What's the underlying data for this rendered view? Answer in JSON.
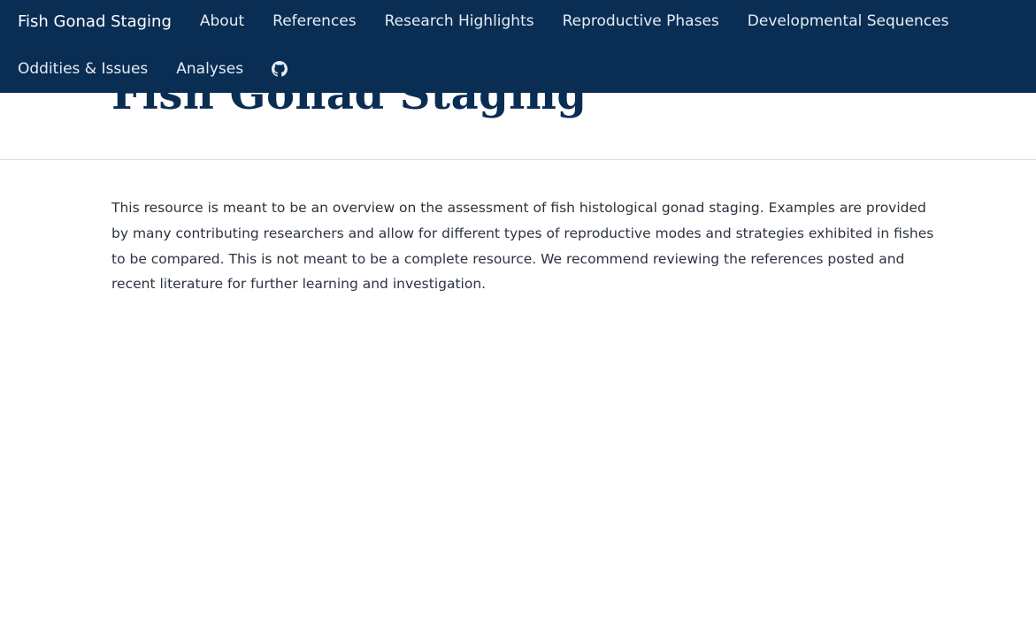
{
  "nav": {
    "brand": "Fish Gonad Staging",
    "links": [
      "About",
      "References",
      "Research Highlights",
      "Reproductive Phases",
      "Developmental Sequences",
      "Oddities & Issues",
      "Analyses"
    ],
    "github_icon": "github-icon"
  },
  "page": {
    "title": "Fish Gonad Staging",
    "intro": "This resource is meant to be an overview on the assessment of fish histological gonad staging. Examples are provided by many contributing researchers and allow for different types of reproductive modes and strategies exhibited in fishes to be compared. This is not meant to be a complete resource. We recommend reviewing the references posted and recent literature for further learning and investigation."
  },
  "colors": {
    "navbar_bg": "#0a2d54",
    "title_color": "#0a2d54",
    "text_color": "#2b3340"
  }
}
